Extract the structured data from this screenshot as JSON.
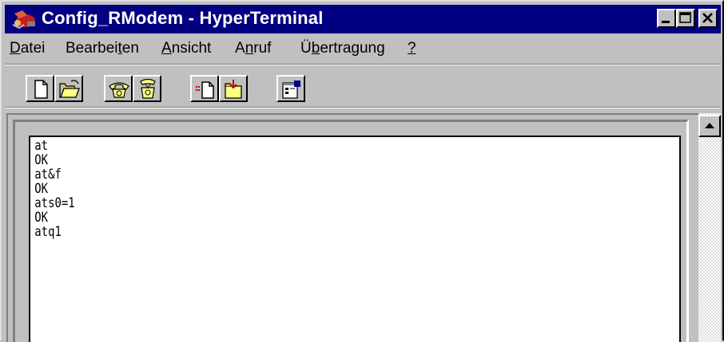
{
  "window": {
    "title": "Config_RModem - HyperTerminal"
  },
  "titlebar_buttons": {
    "minimize_icon": "minimize-icon",
    "maximize_icon": "maximize-icon",
    "close_icon": "close-icon"
  },
  "menu": {
    "items": [
      {
        "pre": "",
        "accel": "D",
        "post": "atei"
      },
      {
        "pre": "Bearbei",
        "accel": "t",
        "post": "en"
      },
      {
        "pre": "",
        "accel": "A",
        "post": "nsicht"
      },
      {
        "pre": "A",
        "accel": "n",
        "post": "ruf"
      },
      {
        "pre": "Ü",
        "accel": "b",
        "post": "ertragung"
      },
      {
        "pre": "",
        "accel": "?",
        "post": ""
      }
    ]
  },
  "toolbar": {
    "buttons": [
      {
        "icon": "new-document-icon"
      },
      {
        "icon": "open-folder-icon"
      },
      {
        "icon": "call-phone-icon"
      },
      {
        "icon": "disconnect-phone-icon"
      },
      {
        "icon": "send-file-icon"
      },
      {
        "icon": "receive-file-icon"
      },
      {
        "icon": "properties-icon"
      }
    ]
  },
  "terminal": {
    "lines": [
      "at",
      "OK",
      "at&f",
      "OK",
      "ats0=1",
      "OK",
      "atq1"
    ]
  },
  "colors": {
    "titlebar": "#000080",
    "face": "#c0c0c0",
    "screen": "#ffffff"
  }
}
